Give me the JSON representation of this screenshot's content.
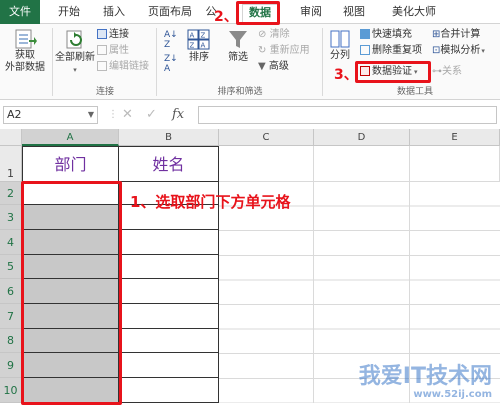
{
  "tabs": {
    "file": "文件",
    "home": "开始",
    "insert": "插入",
    "page_layout": "页面布局",
    "formulas_partial": "公",
    "data": "数据",
    "review": "审阅",
    "view": "视图",
    "meihua": "美化大师"
  },
  "ribbon": {
    "get_external": "获取\n外部数据",
    "refresh_all": "全部刷新",
    "connections": "连接",
    "properties": "属性",
    "edit_links": "编辑链接",
    "group_connections": "连接",
    "sort": "排序",
    "filter": "筛选",
    "clear": "清除",
    "reapply": "重新应用",
    "advanced": "高级",
    "group_sort_filter": "排序和筛选",
    "text_to_columns_partial": "分列",
    "flash_fill": "快速填充",
    "remove_duplicates": "删除重复项",
    "data_validation": "数据验证",
    "consolidate": "合并计算",
    "what_if": "模拟分析",
    "relationships": "关系",
    "group_data_tools": "数据工具"
  },
  "formula_bar": {
    "name_box": "A2",
    "fx": "fx",
    "formula": ""
  },
  "grid": {
    "columns": [
      "A",
      "B",
      "C",
      "D",
      "E"
    ],
    "rows": [
      "1",
      "2",
      "3",
      "4",
      "5",
      "6",
      "7",
      "8",
      "9",
      "10"
    ],
    "header_A": "部门",
    "header_B": "姓名"
  },
  "annotations": {
    "step1": "1、选取部门下方单元格",
    "step2": "2、",
    "step3": "3、"
  },
  "watermark": {
    "line1": "我爱IT技术网",
    "line2": "www.52ij.com"
  },
  "colors": {
    "excel_green": "#217346",
    "annotation_red": "#e8131b",
    "header_purple": "#7030a0",
    "selection_gray": "#c8c8c8"
  }
}
